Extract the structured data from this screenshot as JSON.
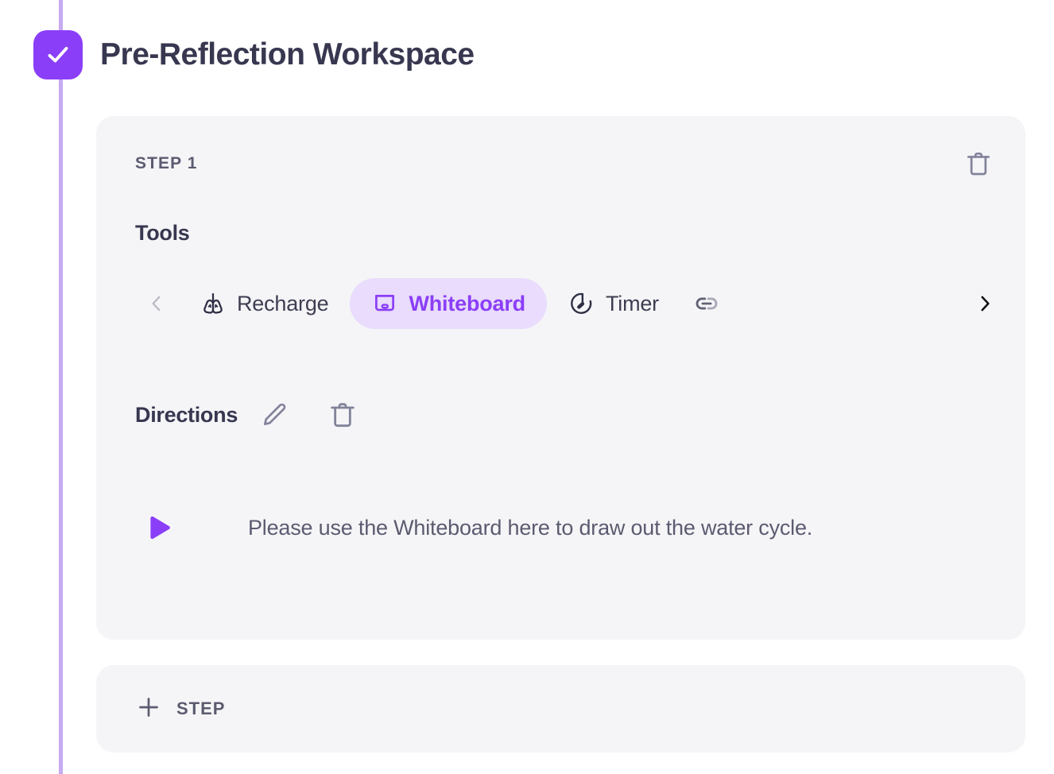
{
  "page": {
    "title": "Pre-Reflection Workspace",
    "accent_color": "#8b3ef7",
    "accent_soft_color": "#e9dcfc",
    "rail_color": "#c6aaf2",
    "card_bg_color": "#f5f5f8",
    "text_color": "#373750",
    "muted_text_color": "#5b5b70",
    "check_icon": "check-icon"
  },
  "step_card": {
    "step_label": "STEP 1",
    "delete_step_icon": "trash-icon",
    "tools": {
      "title": "Tools",
      "prev_icon": "chevron-left-icon",
      "next_icon": "chevron-right-icon",
      "items": [
        {
          "label": "Recharge",
          "icon": "lungs-icon",
          "active": false
        },
        {
          "label": "Whiteboard",
          "icon": "whiteboard-icon",
          "active": true
        },
        {
          "label": "Timer",
          "icon": "stopwatch-icon",
          "active": false
        },
        {
          "label": "",
          "icon": "link-icon",
          "active": false
        }
      ]
    },
    "directions": {
      "title": "Directions",
      "edit_icon": "pencil-icon",
      "delete_icon": "trash-icon",
      "play_icon": "play-icon",
      "text": "Please use the Whiteboard here to draw out the water cycle."
    }
  },
  "add_step": {
    "label": "STEP",
    "icon": "plus-icon"
  }
}
